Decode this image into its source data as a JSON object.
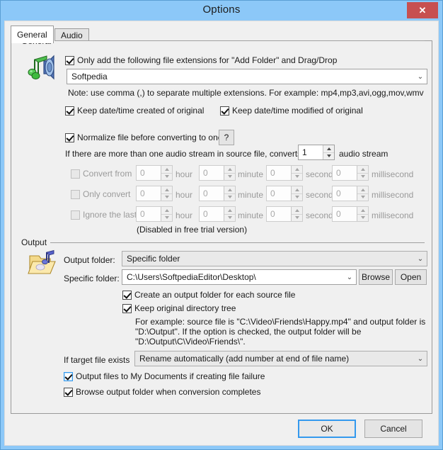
{
  "window": {
    "title": "Options",
    "close_label": "✕",
    "accent_blue": "#8cc8f8",
    "close_red": "#c75050"
  },
  "tabs": [
    {
      "id": "general",
      "label": "General",
      "active": true
    },
    {
      "id": "audio",
      "label": "Audio",
      "active": false
    }
  ],
  "general_group": {
    "label": "General",
    "icon": "music-note-speaker-icon",
    "extensions_checkbox": {
      "label": "Only add the following file extensions for \"Add Folder\" and Drag/Drop",
      "checked": true
    },
    "extensions_combo": {
      "value": "Softpedia",
      "arrow": "⌄"
    },
    "extensions_note": "Note: use comma (,) to separate multiple extensions. For example: mp4,mp3,avi,ogg,mov,wmv",
    "keep_created": {
      "label": "Keep date/time created of original",
      "checked": true
    },
    "keep_modified": {
      "label": "Keep date/time modified of original",
      "checked": true
    },
    "normalize": {
      "label": "Normalize file before converting to one",
      "checked": true
    },
    "help_button": "?",
    "stream_prefix": "If there are more than one audio stream in source file, converts no.",
    "stream_value": "1",
    "stream_suffix": "audio stream",
    "time_rows": [
      {
        "label": "Convert from",
        "checked": false,
        "disabled": true,
        "fields": [
          {
            "value": "0",
            "unit": "hour"
          },
          {
            "value": "0",
            "unit": "minute"
          },
          {
            "value": "0",
            "unit": "second"
          },
          {
            "value": "0",
            "unit": "millisecond"
          }
        ]
      },
      {
        "label": "Only convert",
        "checked": false,
        "disabled": true,
        "fields": [
          {
            "value": "0",
            "unit": "hour"
          },
          {
            "value": "0",
            "unit": "minute"
          },
          {
            "value": "0",
            "unit": "second"
          },
          {
            "value": "0",
            "unit": "millisecond"
          }
        ]
      },
      {
        "label": "Ignore the last",
        "checked": false,
        "disabled": true,
        "fields": [
          {
            "value": "0",
            "unit": "hour"
          },
          {
            "value": "0",
            "unit": "minute"
          },
          {
            "value": "0",
            "unit": "second"
          },
          {
            "value": "0",
            "unit": "millisecond"
          }
        ]
      }
    ],
    "trial_note": "(Disabled in free trial version)"
  },
  "output_group": {
    "label": "Output",
    "icon": "folder-music-icon",
    "output_folder_label": "Output folder:",
    "output_folder_value": "Specific folder",
    "specific_folder_label": "Specific folder:",
    "specific_folder_value": "C:\\Users\\SoftpediaEditor\\Desktop\\",
    "browse_button": "Browse",
    "open_button": "Open",
    "create_output_folder": {
      "label": "Create an output folder for each source file",
      "checked": true
    },
    "keep_tree": {
      "label": "Keep original directory tree",
      "checked": true
    },
    "example_lines": [
      "For example: source file is \"C:\\Video\\Friends\\Happy.mp4\" and output folder is",
      "\"D:\\Output\". If the option is checked, the output folder will be",
      "\"D:\\Output\\C\\Video\\Friends\\\"."
    ],
    "target_exists_label": "If target file exists",
    "target_exists_value": "Rename automatically (add number at end of file name)",
    "output_my_documents": {
      "label": "Output files to My Documents if creating file failure",
      "checked": true,
      "focused": true
    },
    "browse_on_complete": {
      "label": "Browse output folder when conversion completes",
      "checked": true
    }
  },
  "footer": {
    "ok_label": "OK",
    "cancel_label": "Cancel"
  }
}
